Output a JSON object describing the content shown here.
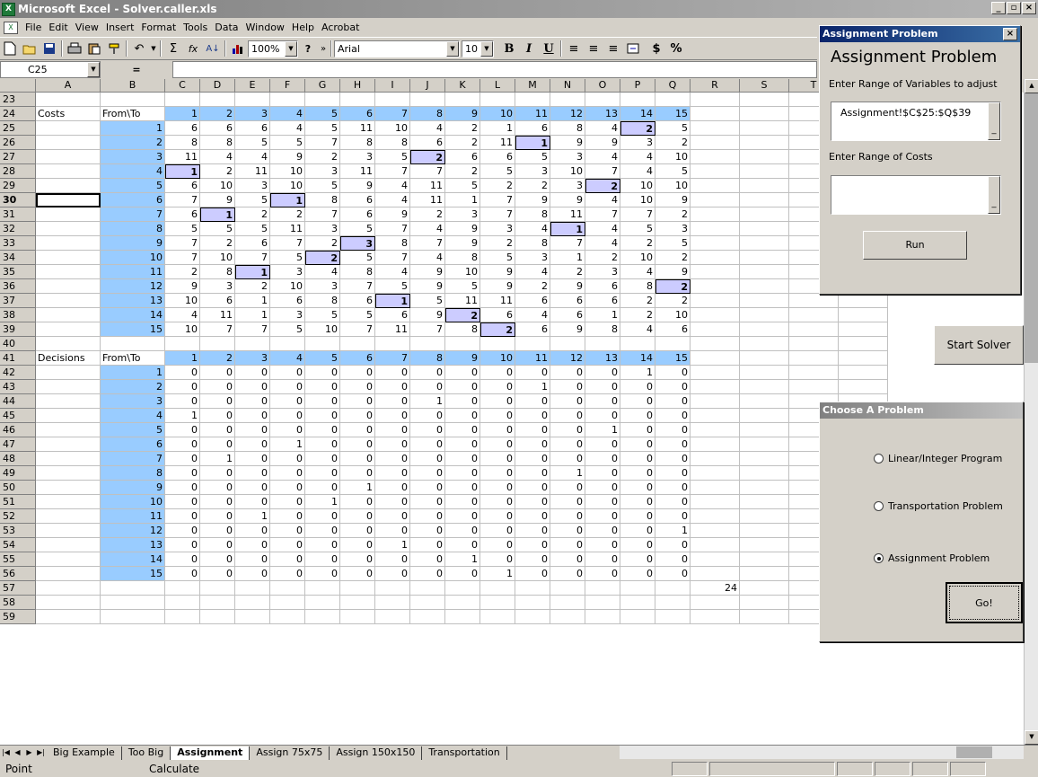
{
  "window": {
    "title": "Microsoft Excel - Solver.caller.xls",
    "minimize": "_",
    "restore": "▫",
    "close": "×",
    "menu_close": "×"
  },
  "menu": [
    "File",
    "Edit",
    "View",
    "Insert",
    "Format",
    "Tools",
    "Data",
    "Window",
    "Help",
    "Acrobat"
  ],
  "toolbar": {
    "zoom": "100%",
    "font": "Arial",
    "size": "10",
    "bold": "B",
    "italic": "I",
    "underline": "U",
    "currency": "$",
    "percent": "%",
    "sigma": "Σ",
    "fx": "fx",
    "sort": "A↓",
    "more": "»"
  },
  "formula_bar": {
    "namebox": "C25",
    "equals": "=",
    "value": ""
  },
  "columns": [
    "A",
    "B",
    "C",
    "D",
    "E",
    "F",
    "G",
    "H",
    "I",
    "J",
    "K",
    "L",
    "M",
    "N",
    "O",
    "P",
    "Q",
    "R",
    "S",
    "T",
    "U"
  ],
  "sheet": {
    "costs_label": "Costs",
    "decisions_label": "Decisions",
    "from_to": "From\\To",
    "col_nums": [
      "1",
      "2",
      "3",
      "4",
      "5",
      "6",
      "7",
      "8",
      "9",
      "10",
      "11",
      "12",
      "13",
      "14",
      "15"
    ],
    "costs": [
      [
        6,
        6,
        6,
        4,
        5,
        11,
        10,
        4,
        2,
        1,
        6,
        8,
        4,
        2,
        5
      ],
      [
        8,
        8,
        5,
        5,
        7,
        8,
        8,
        6,
        2,
        11,
        1,
        9,
        9,
        3,
        2
      ],
      [
        11,
        4,
        4,
        9,
        2,
        3,
        5,
        2,
        6,
        6,
        5,
        3,
        4,
        4,
        10
      ],
      [
        1,
        2,
        11,
        10,
        3,
        11,
        7,
        7,
        2,
        5,
        3,
        10,
        7,
        4,
        5
      ],
      [
        6,
        10,
        3,
        10,
        5,
        9,
        4,
        11,
        5,
        2,
        2,
        3,
        2,
        10,
        10
      ],
      [
        7,
        9,
        5,
        1,
        8,
        6,
        4,
        11,
        1,
        7,
        9,
        9,
        4,
        10,
        9
      ],
      [
        6,
        1,
        2,
        2,
        7,
        6,
        9,
        2,
        3,
        7,
        8,
        11,
        7,
        7,
        2
      ],
      [
        5,
        5,
        5,
        11,
        3,
        5,
        7,
        4,
        9,
        3,
        4,
        1,
        4,
        5,
        3
      ],
      [
        7,
        2,
        6,
        7,
        2,
        3,
        8,
        7,
        9,
        2,
        8,
        7,
        4,
        2,
        5
      ],
      [
        7,
        10,
        7,
        5,
        2,
        5,
        7,
        4,
        8,
        5,
        3,
        1,
        2,
        10,
        2
      ],
      [
        2,
        8,
        1,
        3,
        4,
        8,
        4,
        9,
        10,
        9,
        4,
        2,
        3,
        4,
        9
      ],
      [
        9,
        3,
        2,
        10,
        3,
        7,
        5,
        9,
        5,
        9,
        2,
        9,
        6,
        8,
        2
      ],
      [
        10,
        6,
        1,
        6,
        8,
        6,
        1,
        5,
        11,
        11,
        6,
        6,
        6,
        2,
        2
      ],
      [
        4,
        11,
        1,
        3,
        5,
        5,
        6,
        9,
        2,
        6,
        4,
        6,
        1,
        2,
        10
      ],
      [
        10,
        7,
        7,
        5,
        10,
        7,
        11,
        7,
        8,
        2,
        6,
        9,
        8,
        4,
        6
      ]
    ],
    "assignment": [
      14,
      11,
      8,
      1,
      13,
      4,
      2,
      12,
      6,
      5,
      3,
      15,
      7,
      9,
      10
    ],
    "total": "24"
  },
  "tabs": [
    "Big Example",
    "Too Big",
    "Assignment",
    "Assign 75x75",
    "Assign 150x150",
    "Transportation"
  ],
  "active_tab": "Assignment",
  "status": {
    "left": "Point",
    "middle": "Calculate"
  },
  "assign_dialog": {
    "title": "Assignment Problem",
    "heading": "Assignment Problem",
    "vars_label": "Enter Range of Variables to adjust",
    "vars_value": "Assignment!$C$25:$Q$39",
    "costs_label": "Enter Range of Costs",
    "costs_value": "",
    "run": "Run",
    "close": "×"
  },
  "start_solver": "Start Solver",
  "choose_dialog": {
    "title": "Choose A Problem",
    "options": [
      "Linear/Integer Program",
      "Transportation Problem",
      "Assignment Problem"
    ],
    "selected": 2,
    "go": "Go!"
  }
}
